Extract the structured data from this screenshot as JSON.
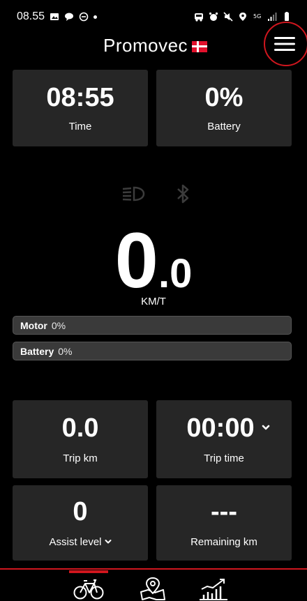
{
  "status_bar": {
    "time": "08.55",
    "left_icons": [
      "image-icon",
      "chat-icon",
      "dnd-icon"
    ],
    "right_icons": [
      "car-icon",
      "alarm-icon",
      "mute-icon",
      "location-icon",
      "5g-icon",
      "signal-icon",
      "battery-icon"
    ]
  },
  "header": {
    "brand": "Promovec",
    "brand_flag": "denmark-flag",
    "menu_icon": "hamburger-menu-icon"
  },
  "top_tiles": [
    {
      "value": "08:55",
      "label": "Time"
    },
    {
      "value": "0%",
      "label": "Battery"
    }
  ],
  "indicators": {
    "light_icon": "headlight-icon",
    "bluetooth_icon": "bluetooth-icon"
  },
  "speed": {
    "integer": "0",
    "decimal": ".0",
    "unit": "KM/T"
  },
  "bars": [
    {
      "name": "Motor",
      "value": "0%",
      "fill_fraction": 0
    },
    {
      "name": "Battery",
      "value": "0%",
      "fill_fraction": 0
    }
  ],
  "stats": [
    {
      "value": "0.0",
      "label": "Trip km"
    },
    {
      "value": "00:00",
      "label": "Trip time"
    },
    {
      "value": "0",
      "label": "Assist level"
    },
    {
      "value": "---",
      "label": "Remaining km"
    }
  ],
  "nav": {
    "tabs": [
      "bike-icon",
      "map-icon",
      "stats-chart-icon"
    ],
    "active": 0
  },
  "colors": {
    "accent": "#d0161e",
    "tile": "#262626",
    "background": "#000000"
  }
}
